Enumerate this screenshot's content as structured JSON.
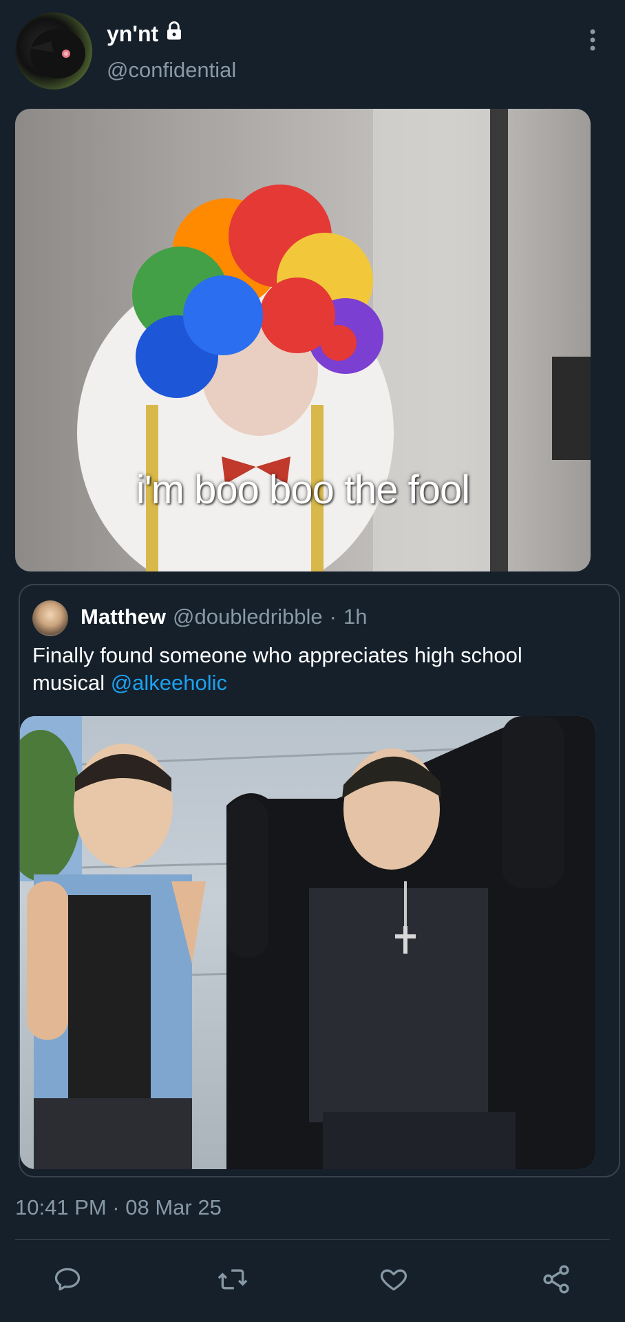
{
  "tweet": {
    "display_name": "yn'nt",
    "handle": "@confidential",
    "image_caption": "i'm boo boo the fool",
    "timestamp": "10:41 PM · 08 Mar 25"
  },
  "quoted": {
    "display_name": "Matthew",
    "handle": "@doubledribble",
    "separator": "·",
    "time": "1h",
    "text": "Finally found someone who appreciates high school musical ",
    "mention": "@alkeeholic"
  },
  "colors": {
    "background": "#15202b",
    "secondary_text": "#8899a6",
    "link": "#1da1f2",
    "border": "#38444d"
  },
  "icons": [
    "lock-icon",
    "more-vertical-icon",
    "reply-icon",
    "retweet-icon",
    "like-icon",
    "share-icon"
  ]
}
